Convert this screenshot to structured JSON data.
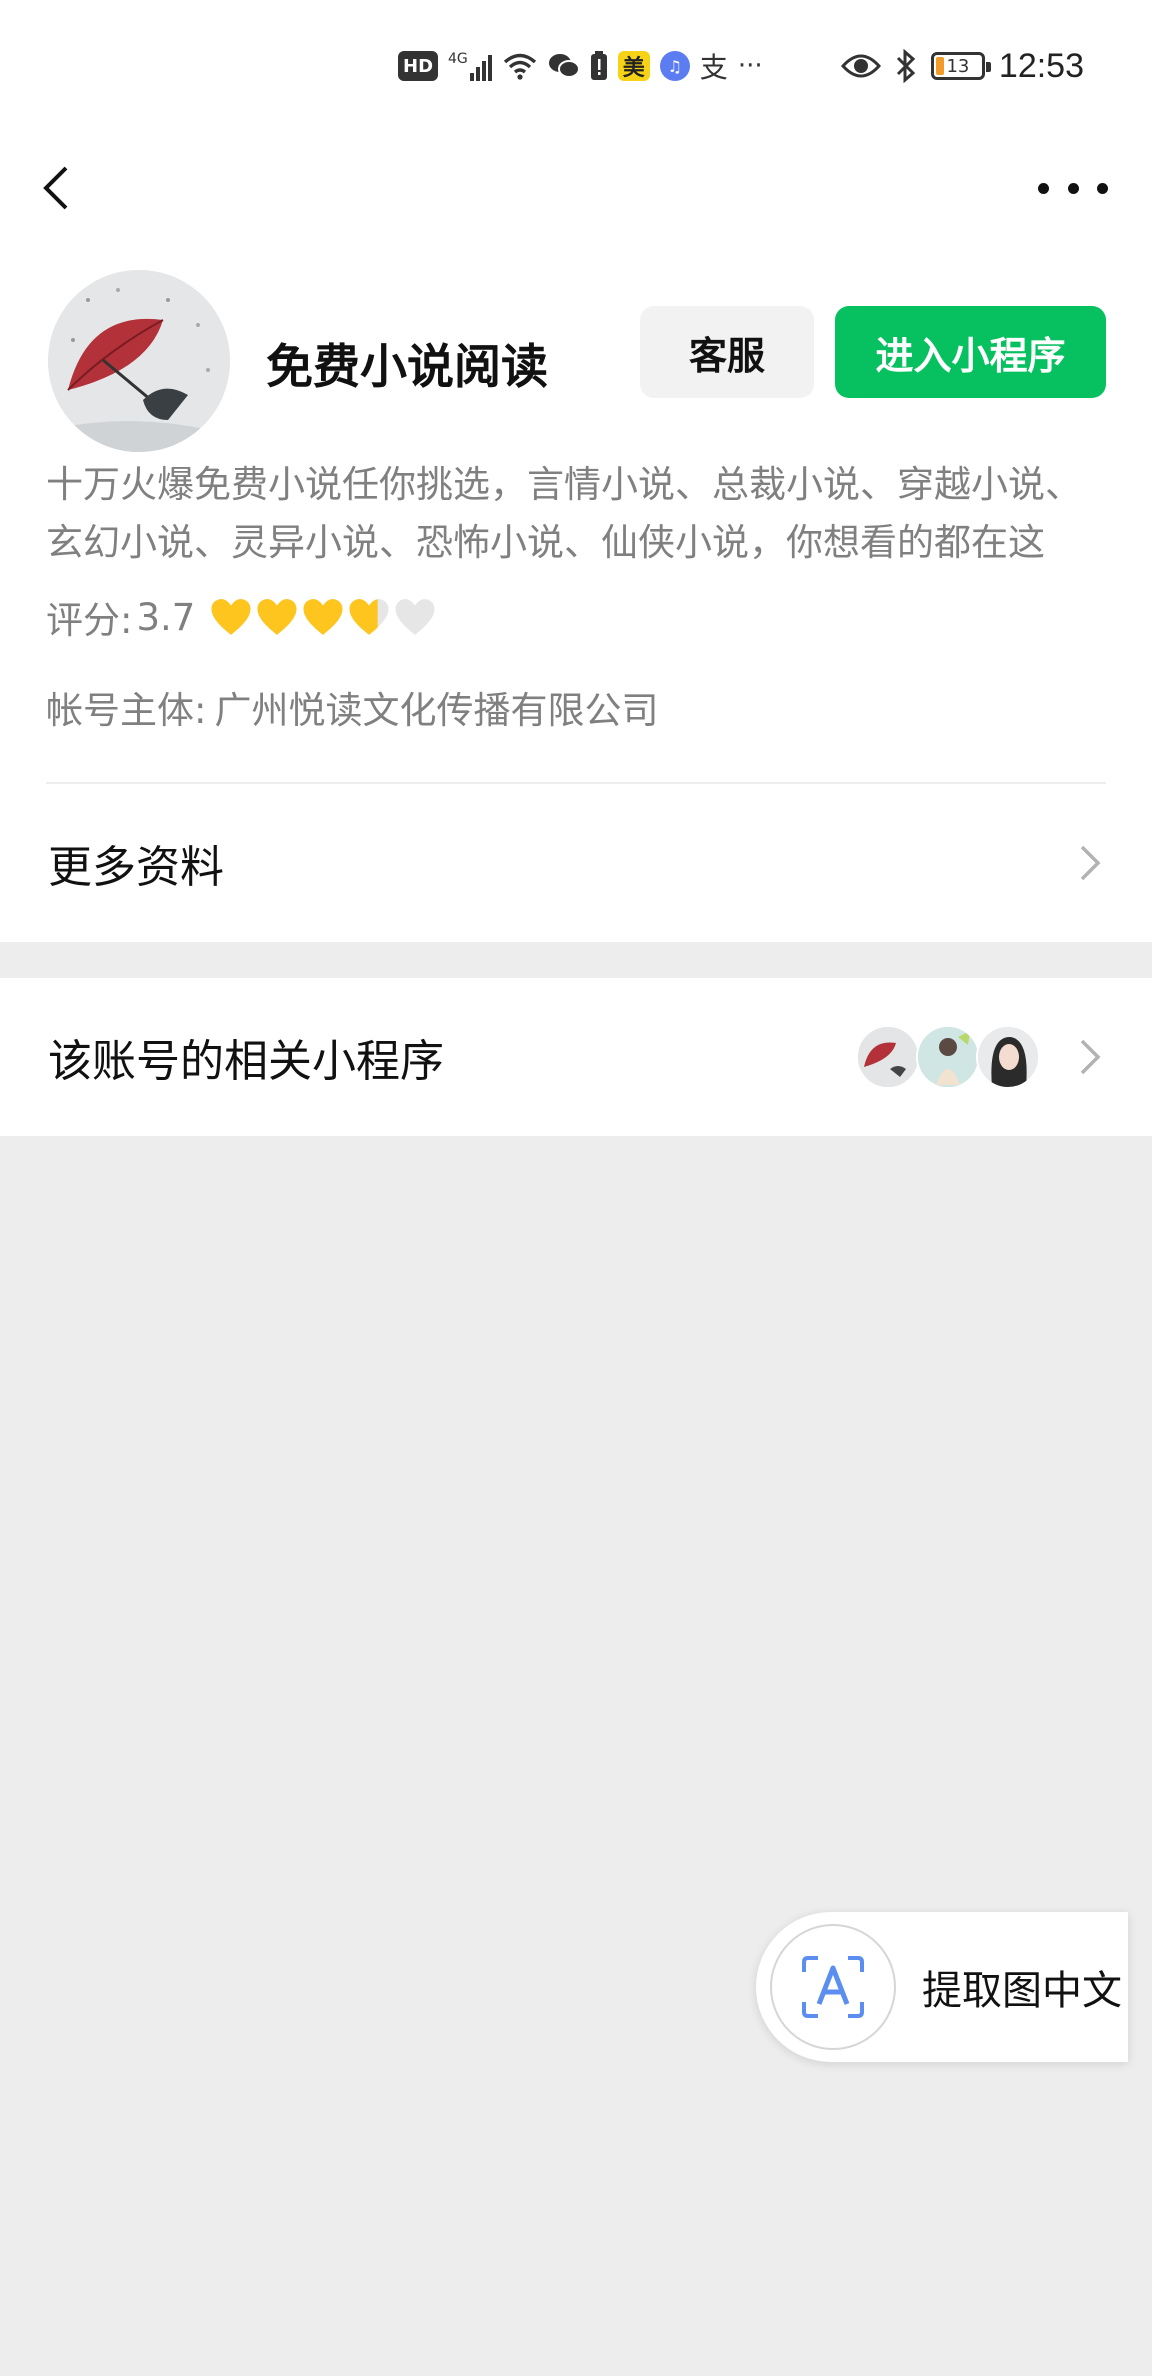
{
  "status_bar": {
    "hd": "HD",
    "network": "4G",
    "meituan": "美",
    "alipay": "支",
    "more": "···",
    "battery": "13",
    "time": "12:53"
  },
  "mini_program": {
    "name": "免费小说阅读",
    "service_button": "客服",
    "enter_button": "进入小程序",
    "description": "十万火爆免费小说任你挑选，言情小说、总裁小说、穿越小说、玄幻小说、灵异小说、恐怖小说、仙侠小说，你想看的都在这",
    "rating_label": "评分:",
    "rating_value": "3.7",
    "rating_fraction": 0.74,
    "account_entity_label": "帐号主体:",
    "account_entity": "广州悦读文化传播有限公司"
  },
  "rows": {
    "more_info": "更多资料",
    "related_mini_programs": "该账号的相关小程序"
  },
  "floating": {
    "extract_text": "提取图中文"
  },
  "colors": {
    "accent": "#07c160",
    "heart": "#fdc51d",
    "background": "#ededed"
  }
}
